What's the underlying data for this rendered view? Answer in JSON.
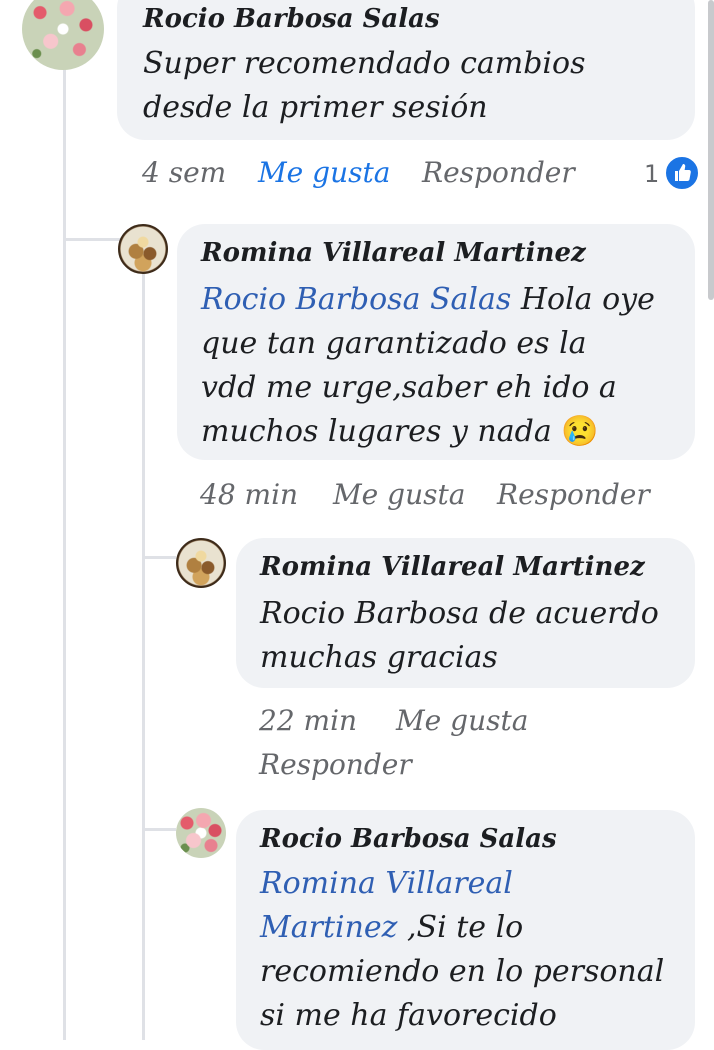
{
  "comments": {
    "c1": {
      "author": "Rocio Barbosa Salas",
      "text_line1": "Super recomendado cambios",
      "text_line2": "desde la primer sesión",
      "time": "4 sem",
      "like": "Me gusta",
      "reply": "Responder",
      "reaction_count": "1"
    },
    "c2": {
      "author": "Romina Villareal Martinez",
      "mention": "Rocio Barbosa Salas",
      "text_line1_rest": " Hola oye",
      "text_line2": "que tan garantizado es la",
      "text_line3": "vdd me urge,saber eh ido a",
      "text_line4": "muchos lugares y nada",
      "emoji": "😢",
      "time": "48 min",
      "like": "Me gusta",
      "reply": "Responder"
    },
    "c3": {
      "author": "Romina Villareal Martinez",
      "text_line1": "Rocio Barbosa de acuerdo",
      "text_line2": "muchas gracias",
      "time": "22 min",
      "like": "Me gusta",
      "reply": "Responder"
    },
    "c4": {
      "author": "Rocio Barbosa Salas",
      "mention_line1": "Romina Villareal",
      "mention_line2": "Martinez",
      "text_line2_rest": " ,Si te lo",
      "text_line3": "recomiendo en lo personal",
      "text_line4": "si me ha favorecido"
    }
  },
  "colors": {
    "bubble": "#f0f2f5",
    "mention": "#2f5fb3",
    "like_blue": "#1b74e4",
    "meta_grey": "#65676b"
  },
  "icons": [
    "thumbs-up-icon"
  ]
}
